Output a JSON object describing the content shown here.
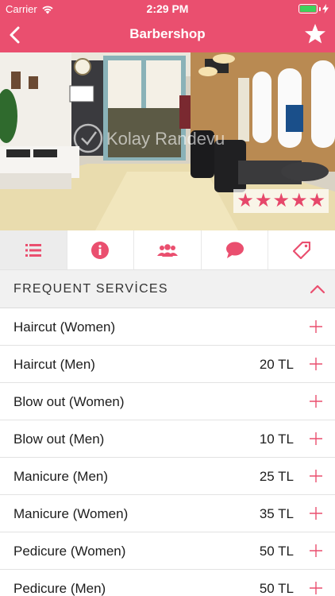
{
  "status_bar": {
    "carrier": "Carrier",
    "time": "2:29 PM"
  },
  "nav": {
    "title": "Barbershop",
    "back_icon": "chevron-left-icon",
    "favorite_icon": "star-icon"
  },
  "hero": {
    "watermark": "Kolay Randevu",
    "rating_stars": 5
  },
  "tabs": [
    {
      "icon": "list-icon",
      "active": true
    },
    {
      "icon": "info-icon",
      "active": false
    },
    {
      "icon": "people-icon",
      "active": false
    },
    {
      "icon": "chat-icon",
      "active": false
    },
    {
      "icon": "tag-icon",
      "active": false
    }
  ],
  "section": {
    "title": "FREQUENT SERVİCES"
  },
  "services": [
    {
      "name": "Haircut (Women)",
      "price": ""
    },
    {
      "name": "Haircut (Men)",
      "price": "20 TL"
    },
    {
      "name": "Blow out (Women)",
      "price": ""
    },
    {
      "name": "Blow out (Men)",
      "price": "10 TL"
    },
    {
      "name": "Manicure (Men)",
      "price": "25 TL"
    },
    {
      "name": "Manicure (Women)",
      "price": "35 TL"
    },
    {
      "name": "Pedicure (Women)",
      "price": "50 TL"
    },
    {
      "name": "Pedicure (Men)",
      "price": "50 TL"
    }
  ],
  "colors": {
    "accent": "#ea4f6f",
    "battery": "#3fd15b",
    "tab_active_bg": "#ececec"
  }
}
